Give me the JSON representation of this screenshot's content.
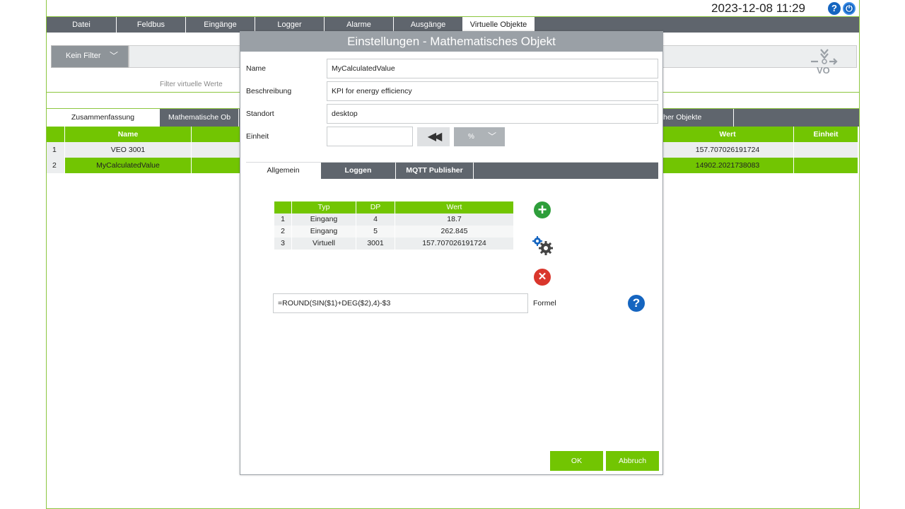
{
  "header": {
    "datetime": "2023-12-08 11:29",
    "help_glyph": "?",
    "power_glyph": "⏻"
  },
  "nav": [
    {
      "label": "Datei"
    },
    {
      "label": "Feldbus"
    },
    {
      "label": "Eingänge"
    },
    {
      "label": "Logger"
    },
    {
      "label": "Alarme"
    },
    {
      "label": "Ausgänge"
    },
    {
      "label": "Virtuelle Objekte"
    }
  ],
  "filter": {
    "select_label": "Kein Filter",
    "caption": "Filter virtuelle Werte"
  },
  "logo": {
    "text": "VO"
  },
  "main_tabs": [
    {
      "label": "Zusammenfassung"
    },
    {
      "label": "Mathematische Ob"
    },
    {
      "label": "her Objekte"
    }
  ],
  "table": {
    "columns": [
      "Name",
      "Wert",
      "Einheit"
    ],
    "rows": [
      {
        "idx": "1",
        "name": "VEO 3001",
        "value": "157.707026191724",
        "unit": ""
      },
      {
        "idx": "2",
        "name": "MyCalculatedValue",
        "value": "14902.2021738083",
        "unit": ""
      }
    ]
  },
  "dialog": {
    "title": "Einstellungen - Mathematisches Objekt",
    "fields": {
      "name_label": "Name",
      "name_value": "MyCalculatedValue",
      "desc_label": "Beschreibung",
      "desc_value": "KPI for energy efficiency",
      "loc_label": "Standort",
      "loc_value": "desktop",
      "unit_label": "Einheit",
      "unit_value": ""
    },
    "unit_select": "%",
    "tabs": [
      {
        "label": "Allgemein"
      },
      {
        "label": "Loggen"
      },
      {
        "label": "MQTT Publisher"
      }
    ],
    "inputs_table": {
      "columns": [
        "Typ",
        "DP",
        "Wert"
      ],
      "rows": [
        {
          "idx": "1",
          "typ": "Eingang",
          "dp": "4",
          "wert": "18.7"
        },
        {
          "idx": "2",
          "typ": "Eingang",
          "dp": "5",
          "wert": "262.845"
        },
        {
          "idx": "3",
          "typ": "Virtuell",
          "dp": "3001",
          "wert": "157.707026191724"
        }
      ]
    },
    "formula": "=ROUND(SIN($1)+DEG($2),4)-$3",
    "formula_label": "Formel",
    "ok_label": "OK",
    "cancel_label": "Abbruch"
  }
}
